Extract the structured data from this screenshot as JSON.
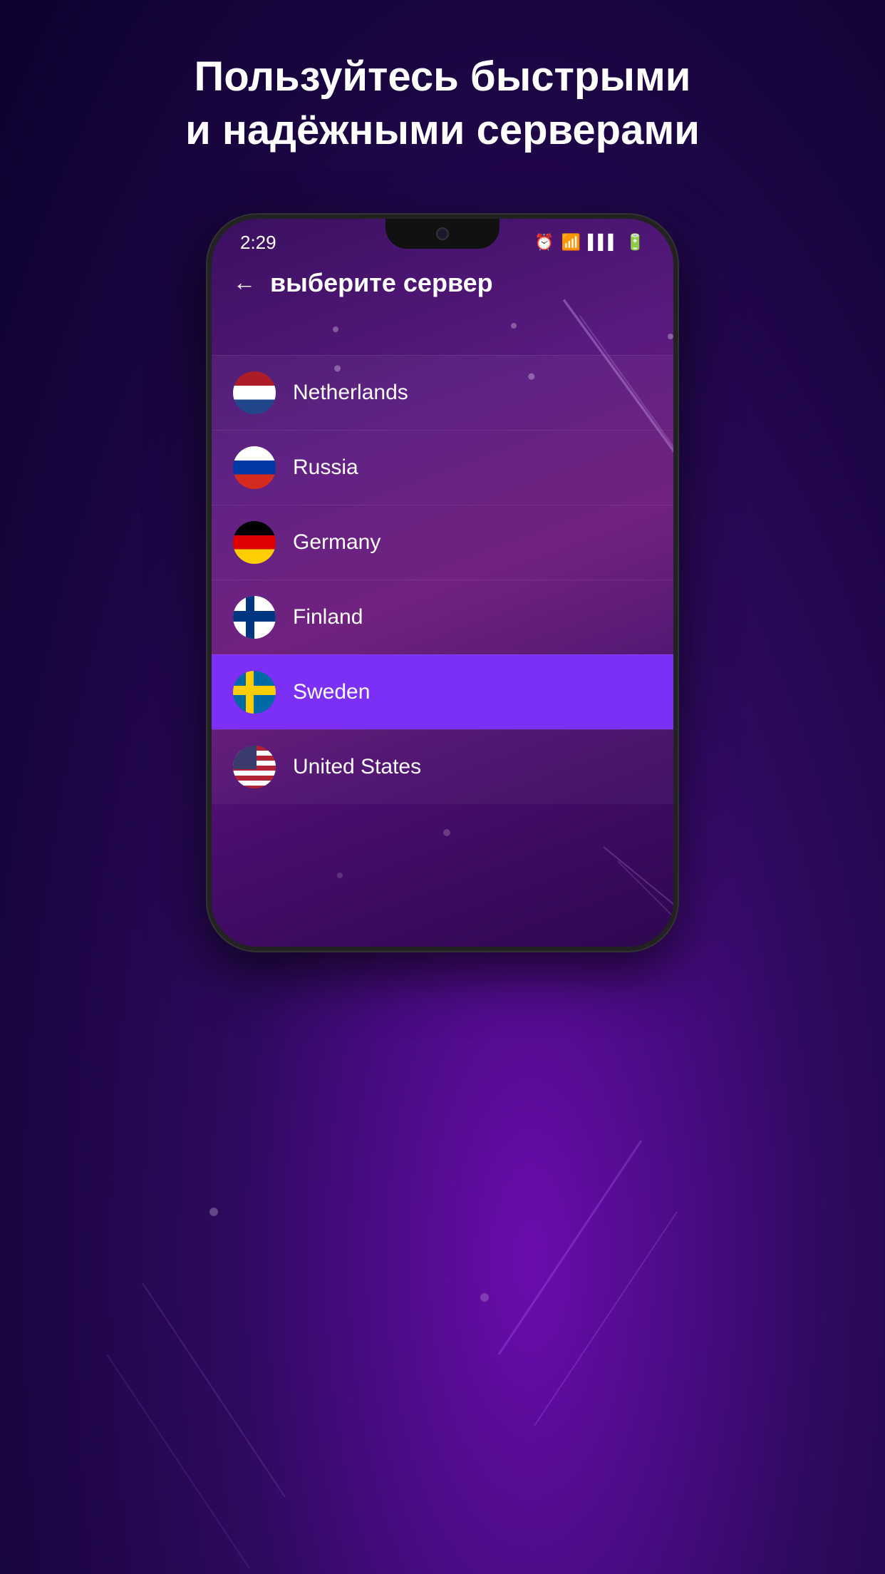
{
  "page": {
    "background_headline": "Пользуйтесь быстрыми\nи надёжными серверами",
    "colors": {
      "bg_dark": "#1a0540",
      "bg_mid": "#2d0a5e",
      "active_item": "#7b2ff7"
    }
  },
  "status_bar": {
    "time": "2:29",
    "icons": [
      "⏰",
      "📶",
      "📶",
      "🔋"
    ]
  },
  "app_header": {
    "back_label": "←",
    "title": "выберите сервер"
  },
  "server_list": {
    "items": [
      {
        "id": "netherlands",
        "name": "Netherlands",
        "flag": "nl",
        "active": false
      },
      {
        "id": "russia",
        "name": "Russia",
        "flag": "ru",
        "active": false
      },
      {
        "id": "germany",
        "name": "Germany",
        "flag": "de",
        "active": false
      },
      {
        "id": "finland",
        "name": "Finland",
        "flag": "fi",
        "active": false
      },
      {
        "id": "sweden",
        "name": "Sweden",
        "flag": "se",
        "active": true
      },
      {
        "id": "united-states",
        "name": "United States",
        "flag": "us",
        "active": false
      }
    ]
  }
}
